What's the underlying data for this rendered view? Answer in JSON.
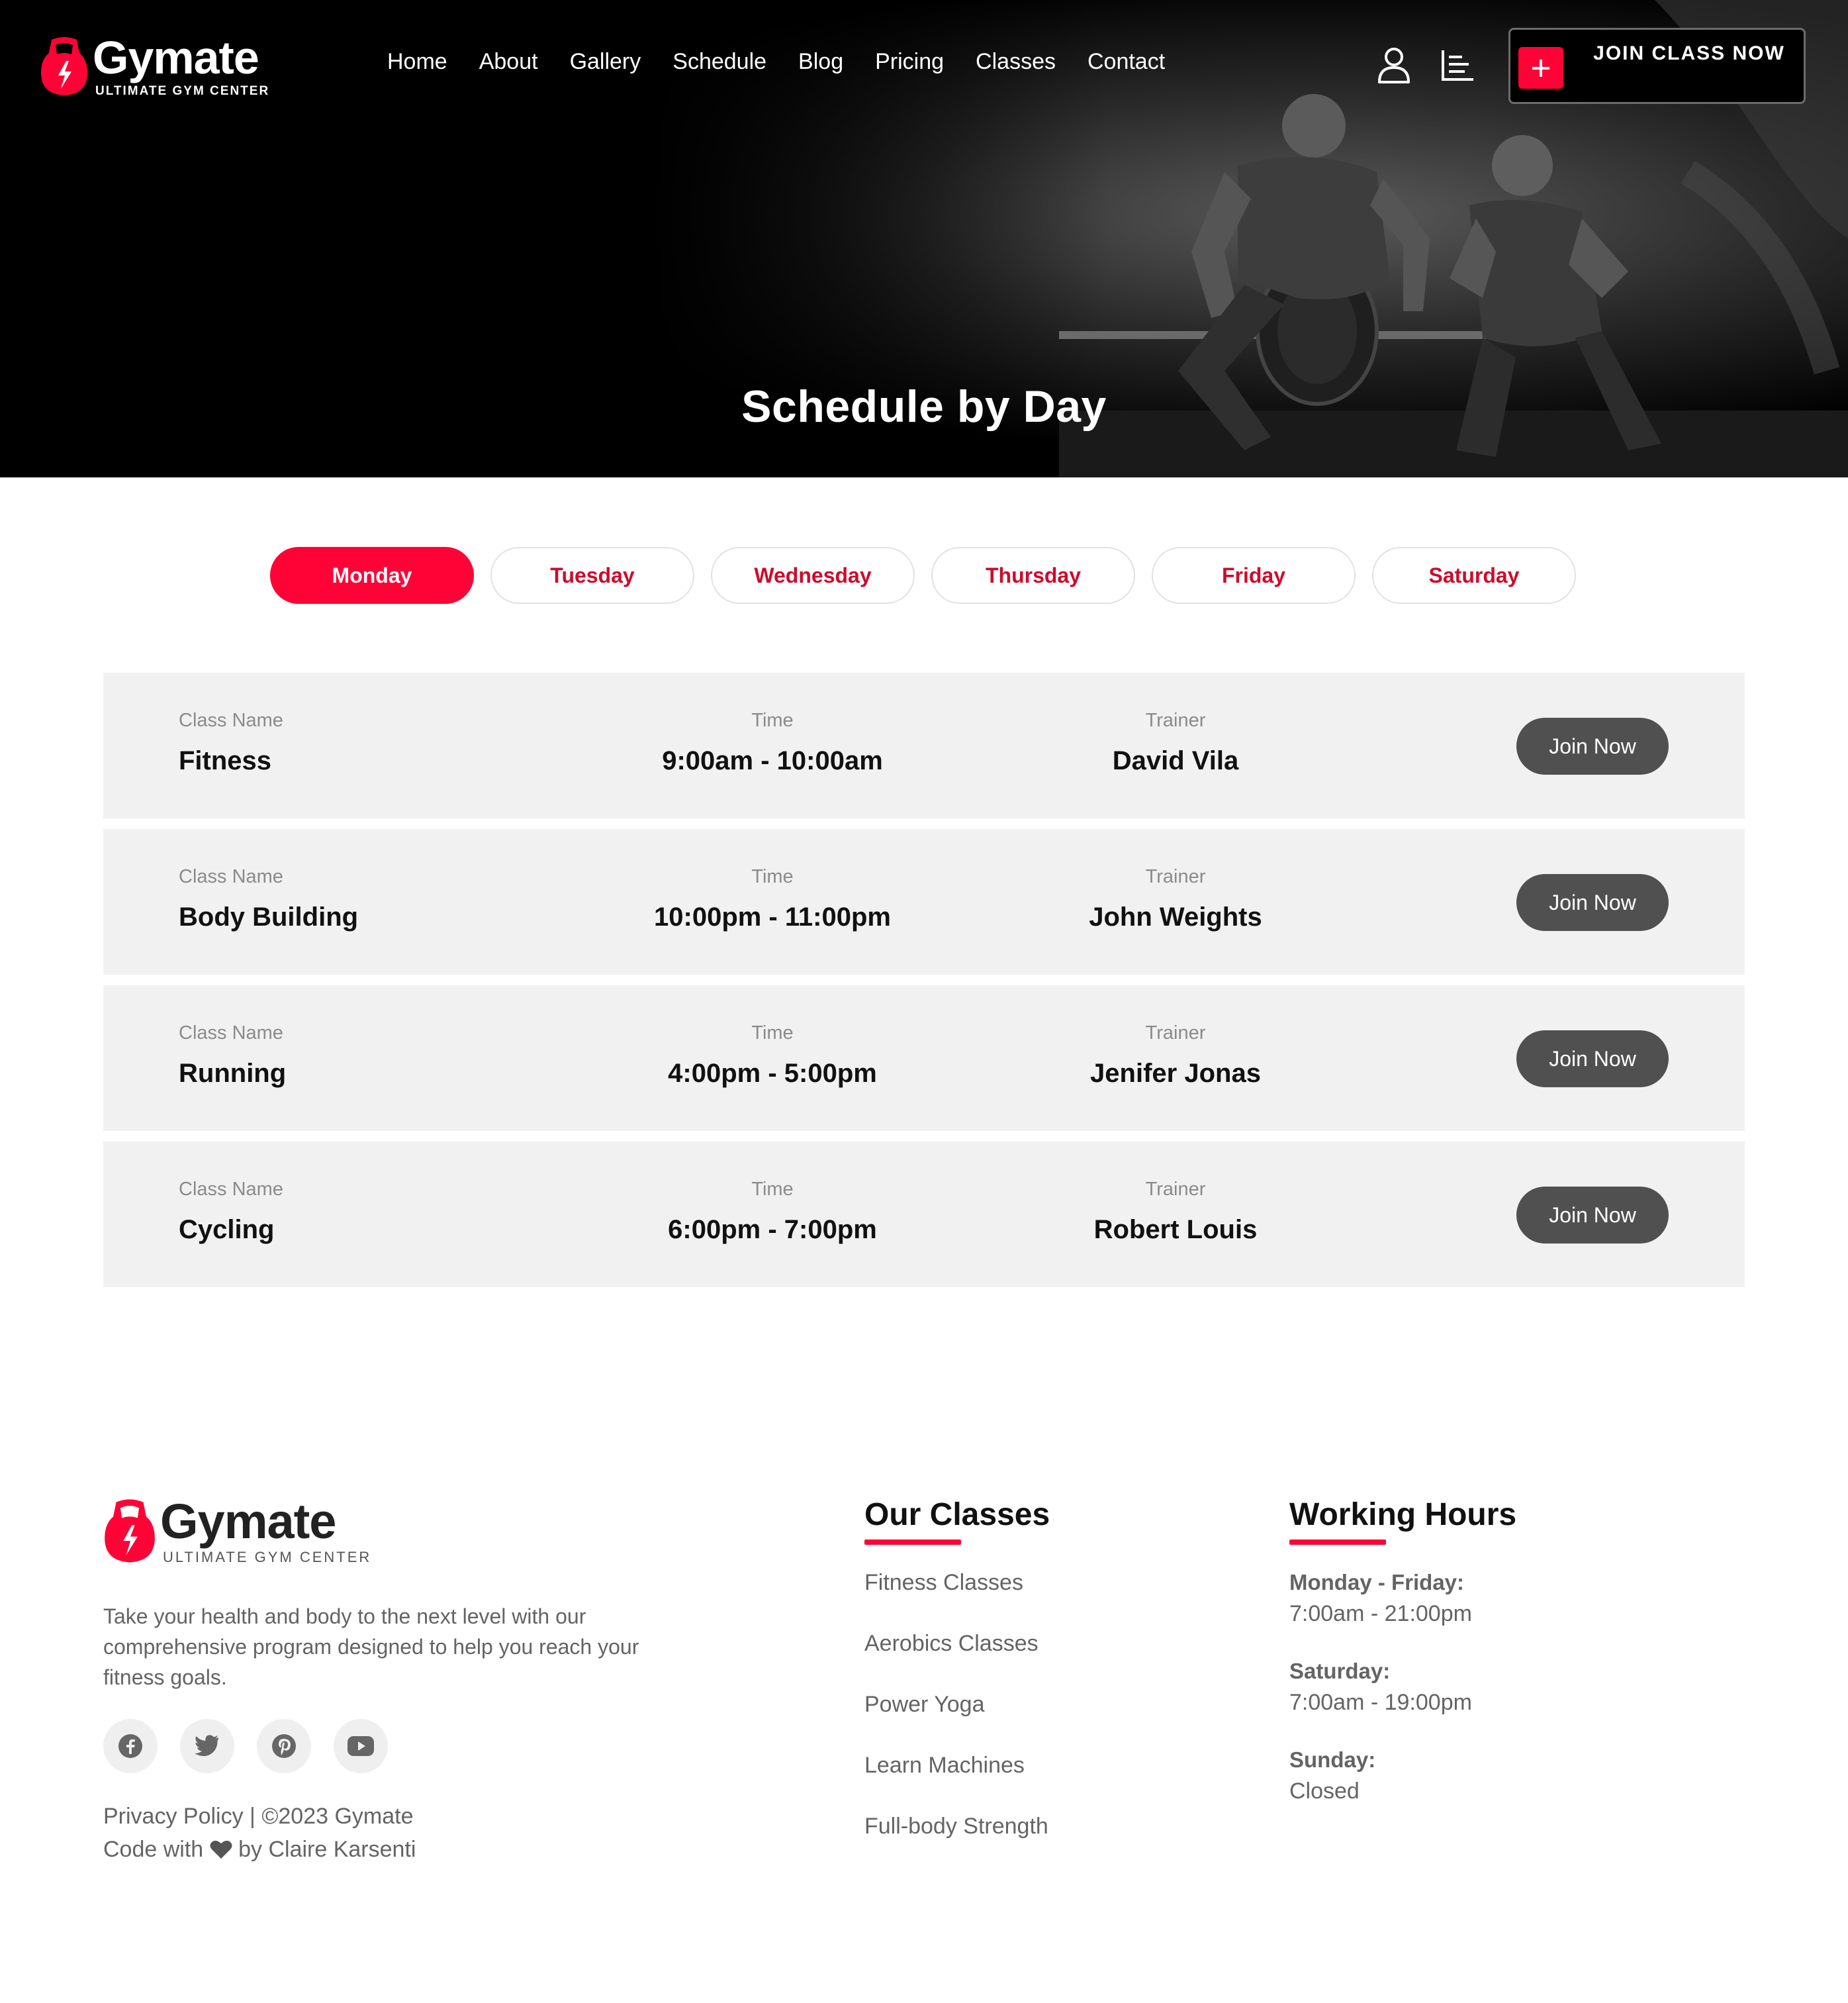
{
  "brand": {
    "name": "Gymate",
    "tagline": "ULTIMATE GYM CENTER",
    "accent": "#ff0336"
  },
  "nav": {
    "links": [
      "Home",
      "About",
      "Gallery",
      "Schedule",
      "Blog",
      "Pricing",
      "Classes",
      "Contact"
    ],
    "join_button": "JOIN CLASS NOW",
    "icons": [
      "user-icon",
      "menu-icon",
      "plus-icon"
    ]
  },
  "hero": {
    "title": "Schedule by Day"
  },
  "tabs": {
    "days": [
      "Monday",
      "Tuesday",
      "Wednesday",
      "Thursday",
      "Friday",
      "Saturday"
    ],
    "active": "Monday"
  },
  "schedule": {
    "labels": {
      "class_name": "Class Name",
      "time": "Time",
      "trainer": "Trainer"
    },
    "button": "Join Now",
    "rows": [
      {
        "name": "Fitness",
        "time": "9:00am - 10:00am",
        "trainer": "David Vila"
      },
      {
        "name": "Body Building",
        "time": "10:00pm - 11:00pm",
        "trainer": "John Weights"
      },
      {
        "name": "Running",
        "time": "4:00pm - 5:00pm",
        "trainer": "Jenifer Jonas"
      },
      {
        "name": "Cycling",
        "time": "6:00pm - 7:00pm",
        "trainer": "Robert Louis"
      }
    ]
  },
  "footer": {
    "description": "Take your health and body to the next level with our comprehensive program designed to help you reach your fitness goals.",
    "socials": [
      "facebook-icon",
      "twitter-icon",
      "pinterest-icon",
      "youtube-icon"
    ],
    "legal_line": "Privacy Policy | ©2023 Gymate",
    "credit_prefix": "Code with",
    "credit_suffix": "by Claire Karsenti",
    "classes": {
      "title": "Our Classes",
      "items": [
        "Fitness Classes",
        "Aerobics Classes",
        "Power Yoga",
        "Learn Machines",
        "Full-body Strength"
      ]
    },
    "hours": {
      "title": "Working Hours",
      "entries": [
        {
          "day": "Monday - Friday:",
          "time": "7:00am - 21:00pm"
        },
        {
          "day": "Saturday:",
          "time": "7:00am - 19:00pm"
        },
        {
          "day": "Sunday:",
          "time": "Closed"
        }
      ]
    }
  }
}
